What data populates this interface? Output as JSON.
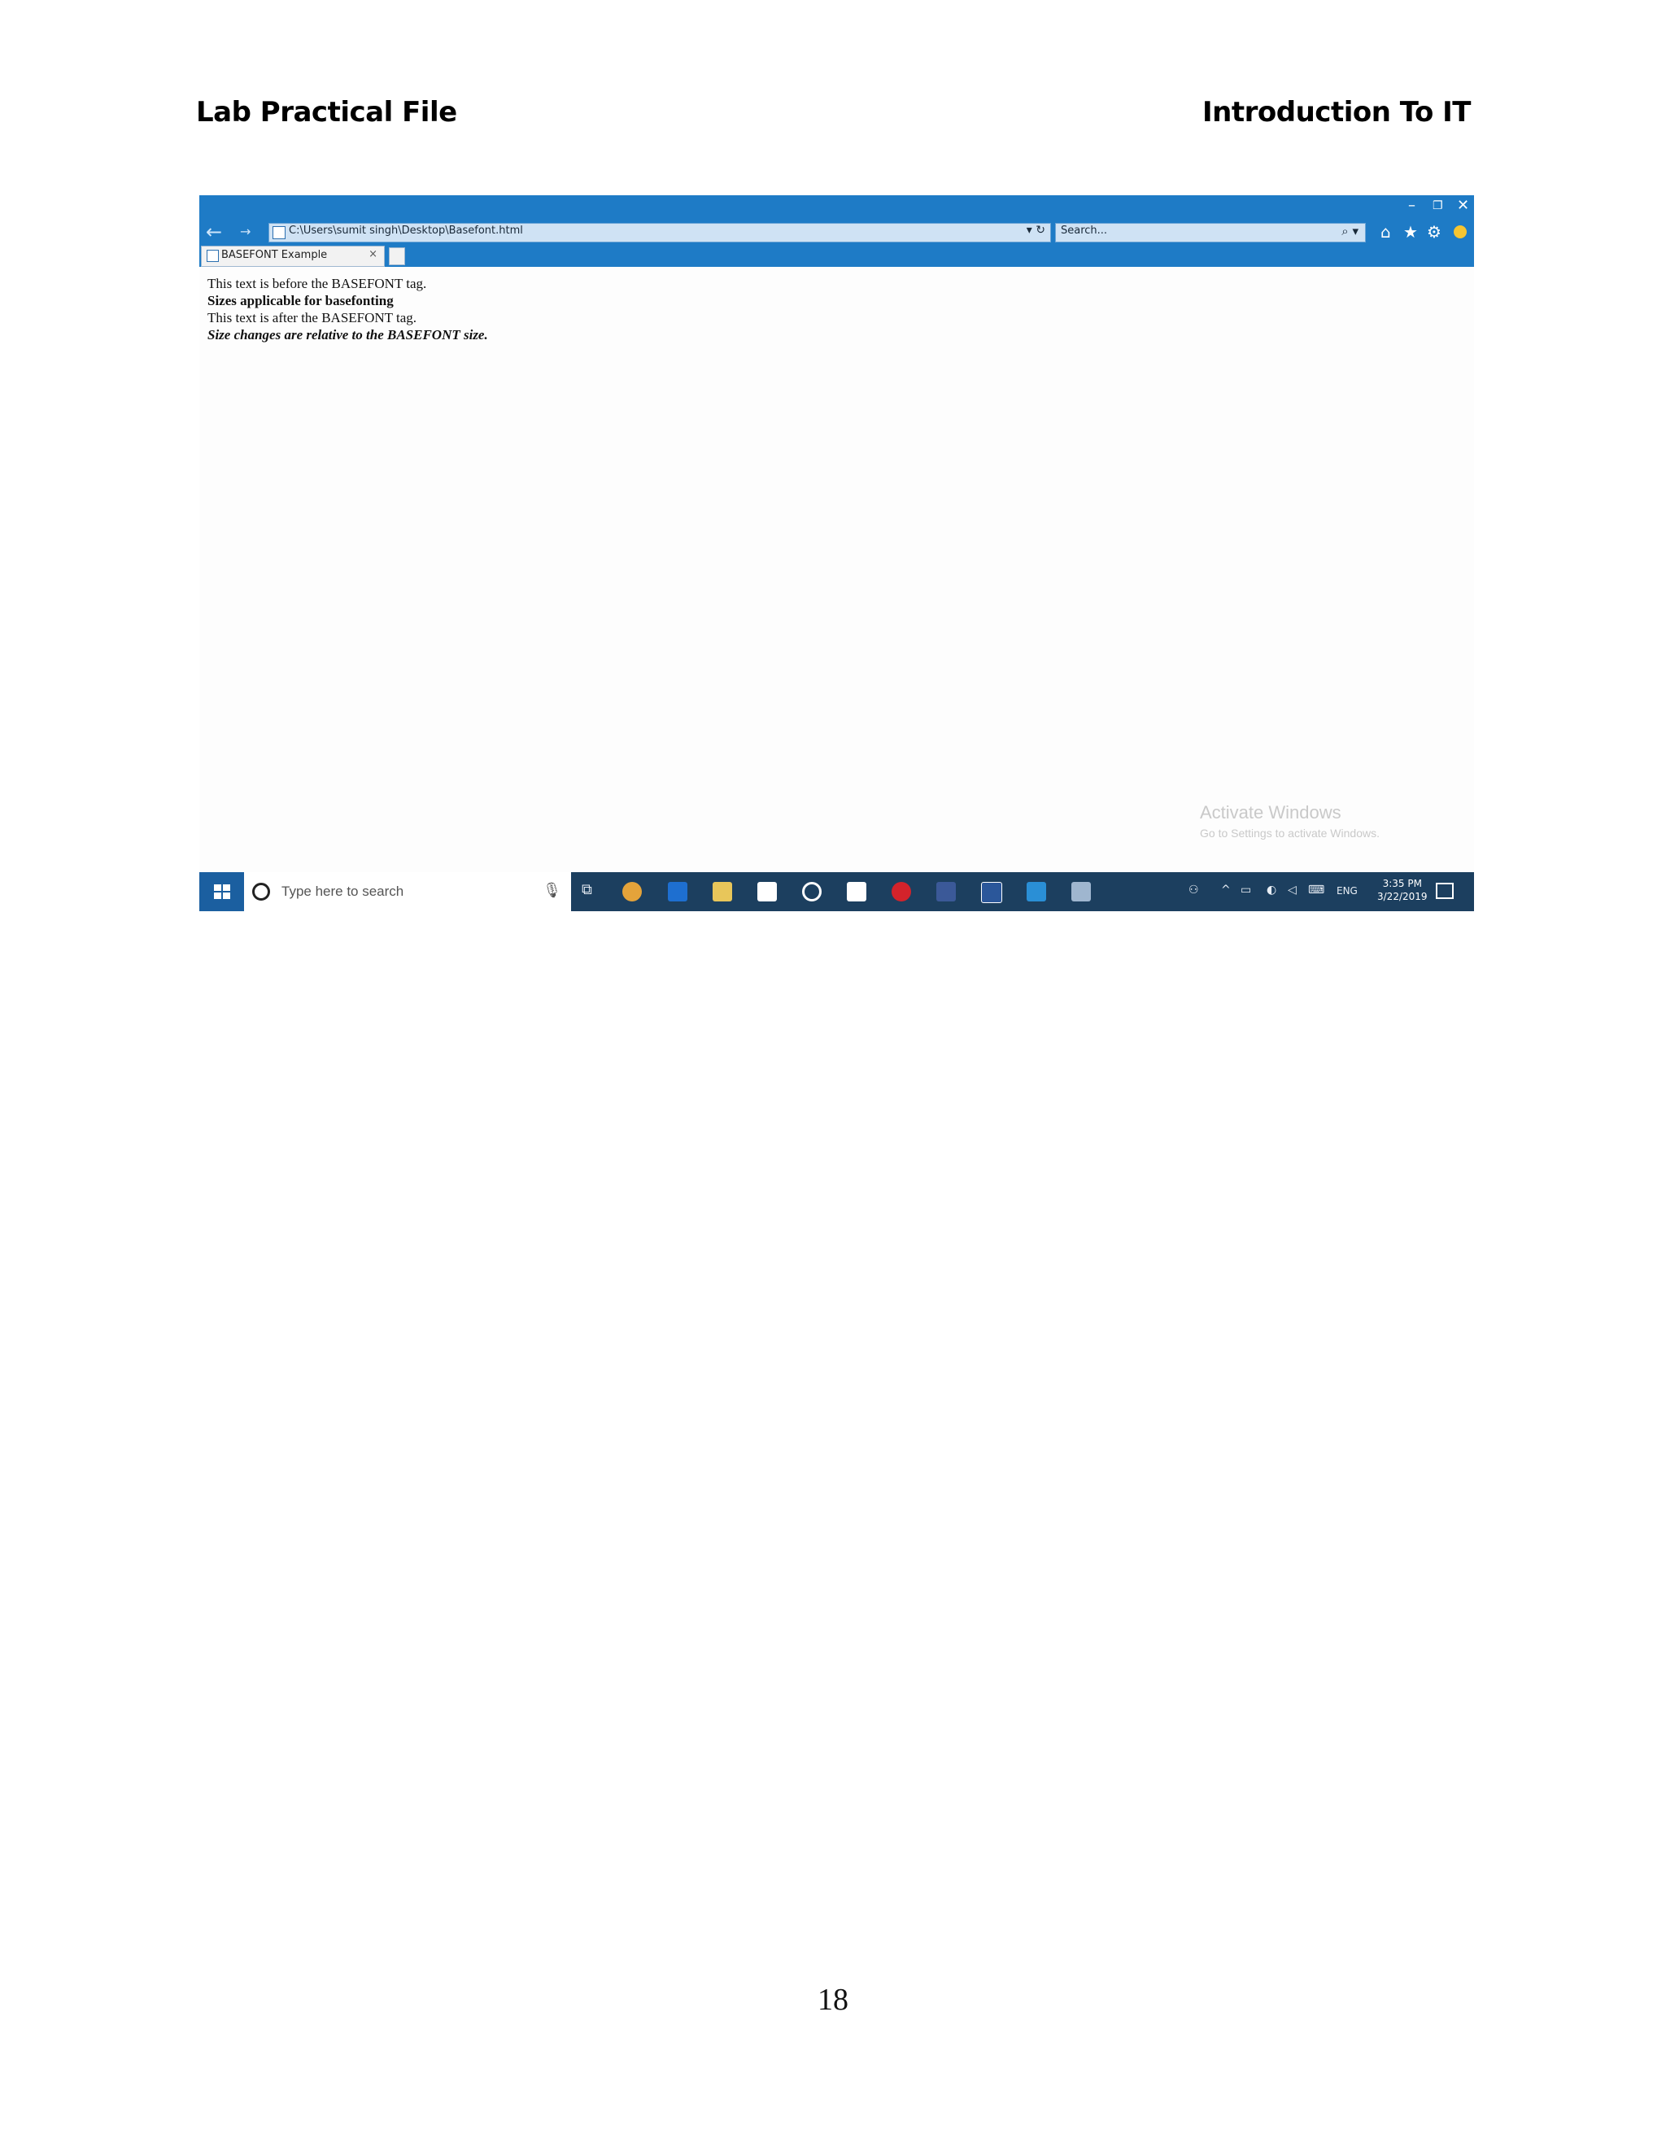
{
  "document": {
    "header_left": "Lab Practical File",
    "header_right": "Introduction To IT",
    "page_number": "18"
  },
  "browser": {
    "window_controls": {
      "minimize": "–",
      "restore": "❐",
      "close": "✕"
    },
    "address_bar": {
      "url": "C:\\Users\\sumit singh\\Desktop\\Basefont.html",
      "controls": "▾ ↻"
    },
    "search_box": {
      "placeholder": "Search...",
      "icon_label": "⌕ ▾"
    },
    "toolbar_icons": [
      "home-icon",
      "favorites-icon",
      "settings-icon",
      "smiley-icon"
    ],
    "tab": {
      "label": "BASEFONT Example",
      "close": "×"
    }
  },
  "page_content": {
    "line1": "This text is before the BASEFONT tag.",
    "line2": "Sizes applicable for basefonting",
    "line3": "This text is after the BASEFONT tag.",
    "line4": "Size changes are relative to the BASEFONT size."
  },
  "watermark": {
    "title": "Activate Windows",
    "subtitle": "Go to Settings to activate Windows."
  },
  "taskbar": {
    "search_placeholder": "Type here to search",
    "apps": [
      "task-view-icon",
      "chrome-icon",
      "edge-icon",
      "file-explorer-icon",
      "store-icon",
      "groove-icon",
      "mail-icon",
      "opera-icon",
      "facebook-icon",
      "word-icon",
      "internet-explorer-icon",
      "notepad-icon"
    ],
    "tray_text": "ENG",
    "time": "3:35 PM",
    "date": "3/22/2019",
    "colors": {
      "taskbar": "#1c3f5f",
      "accent": "#1e7bc6"
    }
  }
}
